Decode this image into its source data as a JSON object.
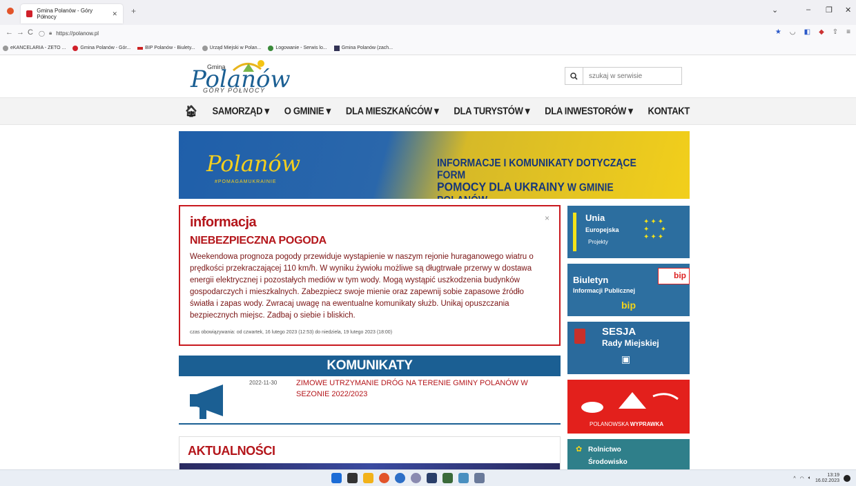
{
  "browser": {
    "tab_title": "Gmina Polanów - Góry Północy",
    "url": "https://polanow.pl",
    "bookmarks": [
      "eKANCELARIA - ZETO ...",
      "Gmina Polanów - Gór...",
      "BIP Polanów - Biulety...",
      "Urząd Miejski w Polan...",
      "Logowanie - Serwis lo...",
      "Gmina Polanów (zach..."
    ]
  },
  "header": {
    "logo_small": "Gmina",
    "logo_main": "Polanów",
    "logo_tagline": "GÓRY PÓŁNOCY",
    "search_placeholder": "szukaj w serwisie"
  },
  "nav": {
    "items": [
      "SAMORZĄD",
      "O GMINIE",
      "DLA MIESZKAŃCÓW",
      "DLA TURYSTÓW",
      "DLA INWESTORÓW",
      "KONTAKT"
    ]
  },
  "banner": {
    "logo": "Polanów",
    "hashtag": "#POMAGAMUKRAINIE",
    "line1": "INFORMACJE I KOMUNIKATY DOTYCZĄCE FORM",
    "line2_strong": "POMOCY DLA UKRAINY",
    "line2_rest": "W GMINIE POLANÓW"
  },
  "alert": {
    "label": "informacja",
    "title": "NIEBEZPIECZNA POGODA",
    "body": "Weekendowa prognoza pogody przewiduje wystąpienie w naszym rejonie huraganowego wiatru o prędkości przekraczającej 110 km/h. W wyniku żywiołu możliwe są długtrwałe przerwy w dostawa energii elektrycznej i pozostałych mediów w tym wody. Mogą wystąpić uszkodzenia budynków gospodarczych i mieszkalnych. Zabezpiecz swoje mienie oraz zapewnij sobie zapasowe źródło światła i zapas wody. Zwracaj uwagę na ewentualne komunikaty służb. Unikaj opuszczania bezpiecznych miejsc. Zadbaj o siebie i bliskich.",
    "meta": "czas obowiązywania: od czwartek, 16 lutego 2023 (12:53) do niedziela, 19 lutego 2023 (18:00)",
    "close": "×"
  },
  "komunikaty": {
    "heading": "KOMUNIKATY",
    "items": [
      {
        "date": "2022-11-30",
        "title": "ZIMOWE UTRZYMANIE DRÓG NA TERENIE GMINY POLANÓW W SEZONIE 2022/2023"
      }
    ]
  },
  "aktualnosci": {
    "heading": "AKTUALNOŚCI"
  },
  "sidebar": {
    "ue": {
      "line1": "Unia",
      "line2": "Europejska",
      "line3": "Projekty"
    },
    "bip": {
      "line1": "Biuletyn",
      "line2": "Informacji Publicznej",
      "badge": "bip",
      "badge2": "bip"
    },
    "sesja": {
      "line1": "SESJA",
      "line2": "Rady Miejskiej"
    },
    "wyprawka": {
      "text1": "POLANOWSKA",
      "text2": "WYPRAWKA"
    },
    "rolnictwo": {
      "line1": "Rolnictwo",
      "line2": "Środowisko"
    }
  },
  "taskbar": {
    "time": "13:19",
    "date": "16.02.2023"
  },
  "colors": {
    "brand_red": "#b4161b",
    "brand_blue": "#1b5f93",
    "alert_border": "#c8181e"
  }
}
